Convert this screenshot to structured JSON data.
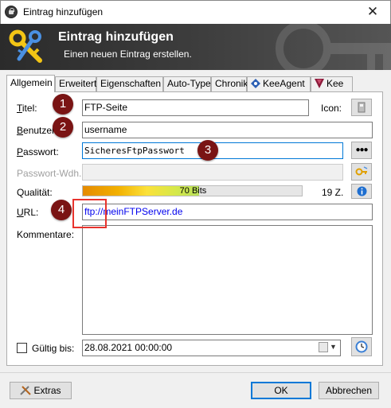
{
  "window": {
    "title": "Eintrag hinzufügen",
    "close_glyph": "✕"
  },
  "banner": {
    "title": "Eintrag hinzufügen",
    "subtitle": "Einen neuen Eintrag erstellen."
  },
  "tabs": [
    {
      "label": "Allgemein",
      "active": true
    },
    {
      "label": "Erweitert"
    },
    {
      "label": "Eigenschaften"
    },
    {
      "label": "Auto-Type"
    },
    {
      "label": "Chronik"
    },
    {
      "label": "KeeAgent",
      "icon": "keeagent-icon"
    },
    {
      "label": "Kee",
      "icon": "kee-icon"
    }
  ],
  "form": {
    "title_label": "Titel:",
    "title_value": "FTP-Seite",
    "icon_label": "Icon:",
    "username_label": "Benutzer",
    "username_value": "username",
    "password_label": "Passwort:",
    "password_value": "SicheresFtpPasswort",
    "reveal_button": "●●●",
    "repeat_label": "Passwort-Wdh.:",
    "quality_label": "Qualität:",
    "quality_bits": "70 Bits",
    "quality_fraction": 0.53,
    "quality_chars": "19 Z.",
    "url_label": "URL:",
    "url_value": "ftp://meinFTPServer.de",
    "notes_label": "Kommentare:",
    "notes_value": "",
    "expires_label": "Gültig bis:",
    "expires_checked": false,
    "expires_value": "28.08.2021 00:00:00"
  },
  "annotations": [
    "1",
    "2",
    "3",
    "4"
  ],
  "footer": {
    "extras_label": "Extras",
    "ok_label": "OK",
    "cancel_label": "Abbrechen"
  },
  "colors": {
    "banner_bg": "#333333",
    "badge": "#7a1414",
    "highlight": "#e8332d",
    "accent": "#0078d7"
  }
}
